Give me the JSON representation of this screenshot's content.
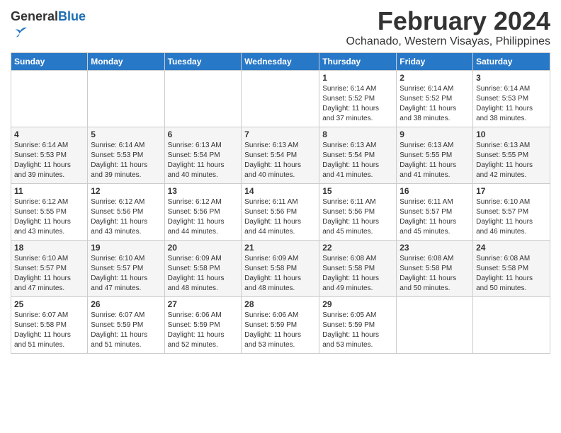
{
  "logo": {
    "general": "General",
    "blue": "Blue"
  },
  "header": {
    "month": "February 2024",
    "location": "Ochanado, Western Visayas, Philippines"
  },
  "weekdays": [
    "Sunday",
    "Monday",
    "Tuesday",
    "Wednesday",
    "Thursday",
    "Friday",
    "Saturday"
  ],
  "weeks": [
    [
      {
        "day": "",
        "info": ""
      },
      {
        "day": "",
        "info": ""
      },
      {
        "day": "",
        "info": ""
      },
      {
        "day": "",
        "info": ""
      },
      {
        "day": "1",
        "info": "Sunrise: 6:14 AM\nSunset: 5:52 PM\nDaylight: 11 hours\nand 37 minutes."
      },
      {
        "day": "2",
        "info": "Sunrise: 6:14 AM\nSunset: 5:52 PM\nDaylight: 11 hours\nand 38 minutes."
      },
      {
        "day": "3",
        "info": "Sunrise: 6:14 AM\nSunset: 5:53 PM\nDaylight: 11 hours\nand 38 minutes."
      }
    ],
    [
      {
        "day": "4",
        "info": "Sunrise: 6:14 AM\nSunset: 5:53 PM\nDaylight: 11 hours\nand 39 minutes."
      },
      {
        "day": "5",
        "info": "Sunrise: 6:14 AM\nSunset: 5:53 PM\nDaylight: 11 hours\nand 39 minutes."
      },
      {
        "day": "6",
        "info": "Sunrise: 6:13 AM\nSunset: 5:54 PM\nDaylight: 11 hours\nand 40 minutes."
      },
      {
        "day": "7",
        "info": "Sunrise: 6:13 AM\nSunset: 5:54 PM\nDaylight: 11 hours\nand 40 minutes."
      },
      {
        "day": "8",
        "info": "Sunrise: 6:13 AM\nSunset: 5:54 PM\nDaylight: 11 hours\nand 41 minutes."
      },
      {
        "day": "9",
        "info": "Sunrise: 6:13 AM\nSunset: 5:55 PM\nDaylight: 11 hours\nand 41 minutes."
      },
      {
        "day": "10",
        "info": "Sunrise: 6:13 AM\nSunset: 5:55 PM\nDaylight: 11 hours\nand 42 minutes."
      }
    ],
    [
      {
        "day": "11",
        "info": "Sunrise: 6:12 AM\nSunset: 5:55 PM\nDaylight: 11 hours\nand 43 minutes."
      },
      {
        "day": "12",
        "info": "Sunrise: 6:12 AM\nSunset: 5:56 PM\nDaylight: 11 hours\nand 43 minutes."
      },
      {
        "day": "13",
        "info": "Sunrise: 6:12 AM\nSunset: 5:56 PM\nDaylight: 11 hours\nand 44 minutes."
      },
      {
        "day": "14",
        "info": "Sunrise: 6:11 AM\nSunset: 5:56 PM\nDaylight: 11 hours\nand 44 minutes."
      },
      {
        "day": "15",
        "info": "Sunrise: 6:11 AM\nSunset: 5:56 PM\nDaylight: 11 hours\nand 45 minutes."
      },
      {
        "day": "16",
        "info": "Sunrise: 6:11 AM\nSunset: 5:57 PM\nDaylight: 11 hours\nand 45 minutes."
      },
      {
        "day": "17",
        "info": "Sunrise: 6:10 AM\nSunset: 5:57 PM\nDaylight: 11 hours\nand 46 minutes."
      }
    ],
    [
      {
        "day": "18",
        "info": "Sunrise: 6:10 AM\nSunset: 5:57 PM\nDaylight: 11 hours\nand 47 minutes."
      },
      {
        "day": "19",
        "info": "Sunrise: 6:10 AM\nSunset: 5:57 PM\nDaylight: 11 hours\nand 47 minutes."
      },
      {
        "day": "20",
        "info": "Sunrise: 6:09 AM\nSunset: 5:58 PM\nDaylight: 11 hours\nand 48 minutes."
      },
      {
        "day": "21",
        "info": "Sunrise: 6:09 AM\nSunset: 5:58 PM\nDaylight: 11 hours\nand 48 minutes."
      },
      {
        "day": "22",
        "info": "Sunrise: 6:08 AM\nSunset: 5:58 PM\nDaylight: 11 hours\nand 49 minutes."
      },
      {
        "day": "23",
        "info": "Sunrise: 6:08 AM\nSunset: 5:58 PM\nDaylight: 11 hours\nand 50 minutes."
      },
      {
        "day": "24",
        "info": "Sunrise: 6:08 AM\nSunset: 5:58 PM\nDaylight: 11 hours\nand 50 minutes."
      }
    ],
    [
      {
        "day": "25",
        "info": "Sunrise: 6:07 AM\nSunset: 5:58 PM\nDaylight: 11 hours\nand 51 minutes."
      },
      {
        "day": "26",
        "info": "Sunrise: 6:07 AM\nSunset: 5:59 PM\nDaylight: 11 hours\nand 51 minutes."
      },
      {
        "day": "27",
        "info": "Sunrise: 6:06 AM\nSunset: 5:59 PM\nDaylight: 11 hours\nand 52 minutes."
      },
      {
        "day": "28",
        "info": "Sunrise: 6:06 AM\nSunset: 5:59 PM\nDaylight: 11 hours\nand 53 minutes."
      },
      {
        "day": "29",
        "info": "Sunrise: 6:05 AM\nSunset: 5:59 PM\nDaylight: 11 hours\nand 53 minutes."
      },
      {
        "day": "",
        "info": ""
      },
      {
        "day": "",
        "info": ""
      }
    ]
  ]
}
